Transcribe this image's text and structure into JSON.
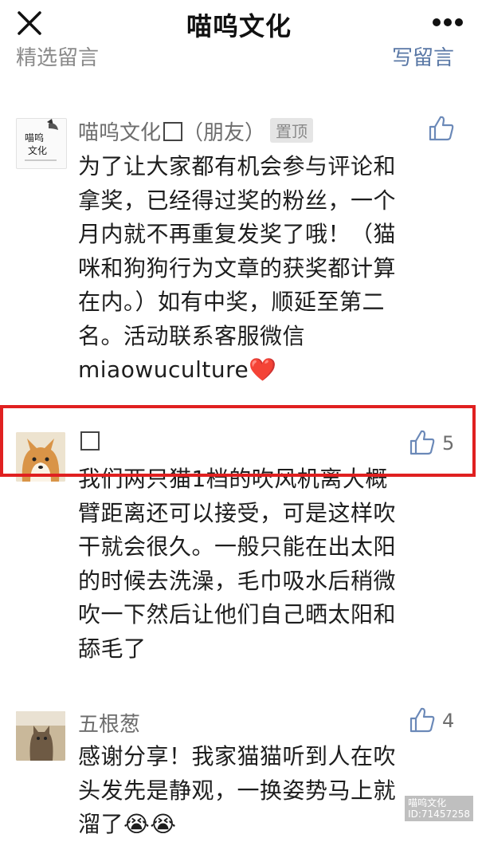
{
  "header": {
    "title": "喵呜文化"
  },
  "section": {
    "left_label": "精选留言",
    "right_label": "写留言"
  },
  "comments": [
    {
      "author": "喵呜文化",
      "tag": "（朋友）",
      "badge": "置顶",
      "likes": "",
      "lines": [
        "为了让大家都有机会参与评论和",
        "拿奖，已经得过奖的粉丝，一个",
        "月内就不再重复发奖了哦！（猫",
        "咪和狗狗行为文章的获奖都计算",
        "在内。）如有中奖，顺延至第二",
        "名。活动联系客服微信",
        "miaowuculture"
      ],
      "emoji": "❤️"
    },
    {
      "author": "",
      "likes": "5",
      "lines": [
        "我们两只猫1档的吹风机离大概",
        "臂距离还可以接受，可是这样吹",
        "干就会很久。一般只能在出太阳",
        "的时候去洗澡，毛巾吸水后稍微",
        "吹一下然后让他们自己晒太阳和",
        "舔毛了"
      ]
    },
    {
      "author": "五根葱",
      "likes": "4",
      "lines": [
        "感谢分享！我家猫猫听到人在吹",
        "头发先是静观，一换姿势马上就",
        "溜了😭😭"
      ]
    }
  ],
  "avatar1_text": [
    "喵呜",
    "文化"
  ],
  "watermark": {
    "line1": "喵呜文化",
    "line2": "ID:71457258"
  },
  "colors": {
    "highlight": "#e02020",
    "link": "#5a78a6",
    "heart": "#e0332e"
  }
}
